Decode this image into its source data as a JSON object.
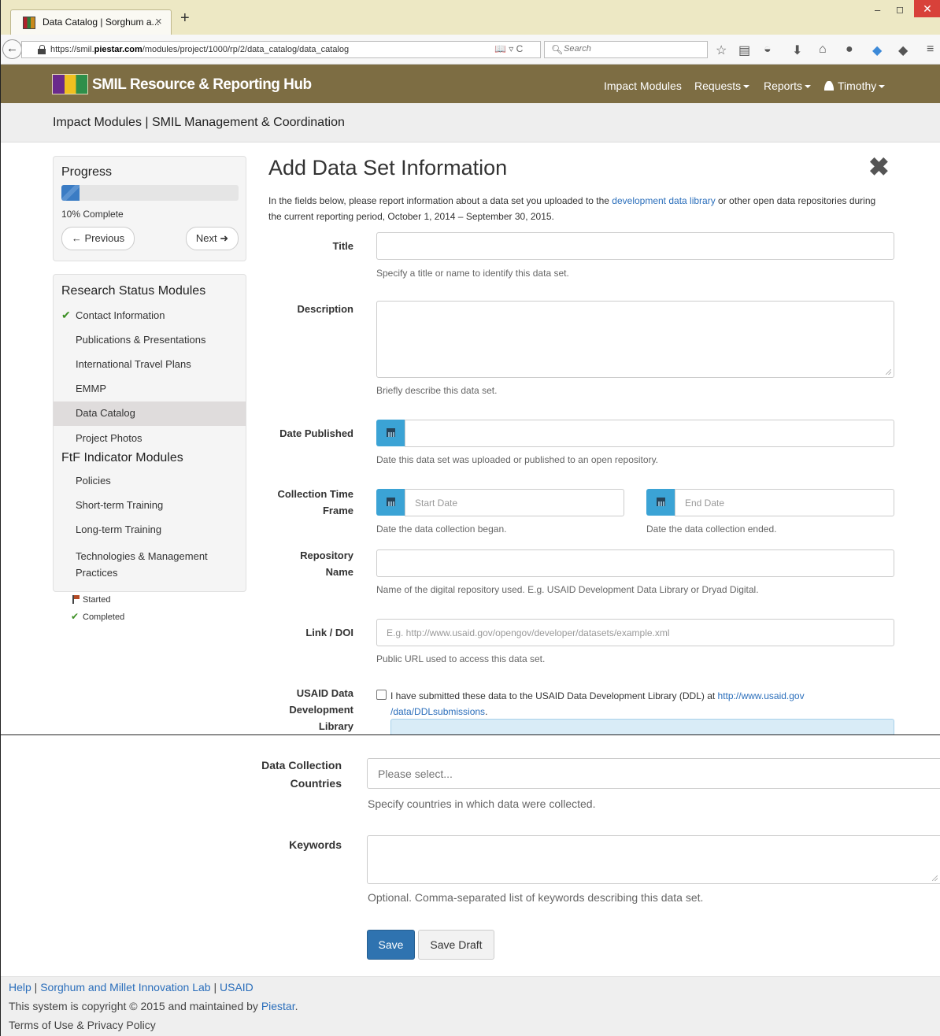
{
  "browser": {
    "tab_title": "Data Catalog | Sorghum a...",
    "tab_close": "×",
    "new_tab": "+",
    "url_prefix": "https://smil.",
    "url_domain": "piestar.com",
    "url_path": "/modules/project/1000/rp/2/data_catalog/data_catalog",
    "reader_icons": "📖 ▿ C",
    "search_placeholder": "Search",
    "window_min": "–",
    "window_max": "◻",
    "window_close": "✕"
  },
  "site": {
    "title": "SMIL Resource & Reporting Hub",
    "nav": {
      "impact_modules": "Impact Modules",
      "requests": "Requests",
      "reports": "Reports",
      "user": "Timothy"
    }
  },
  "subheader": {
    "title": "Impact Modules | SMIL Management & Coordination"
  },
  "progress": {
    "heading": "Progress",
    "value": 10,
    "label": "10% Complete",
    "previous": "← Previous",
    "next": "Next ➜"
  },
  "sidebar": {
    "research_heading": "Research Status Modules",
    "research_items": [
      {
        "label": "Contact Information",
        "completed": true
      },
      {
        "label": "Publications & Presentations"
      },
      {
        "label": "International Travel Plans"
      },
      {
        "label": "EMMP"
      },
      {
        "label": "Data Catalog",
        "active": true
      },
      {
        "label": "Project Photos"
      }
    ],
    "ftf_heading": "FtF Indicator Modules",
    "ftf_items": [
      {
        "label": "Policies"
      },
      {
        "label": "Short-term Training"
      },
      {
        "label": "Long-term Training"
      },
      {
        "label": "Technologies & Management Practices"
      }
    ],
    "legend": {
      "started": "Started",
      "completed": "Completed"
    }
  },
  "form": {
    "heading": "Add Data Set Information",
    "close_symbol": "✖",
    "intro_before": "In the fields below, please report information about a data set you uploaded to the ",
    "intro_link": "development data library",
    "intro_after": " or other open data repositories during the current reporting period, October 1, 2014 – September 30, 2015.",
    "title": {
      "label": "Title",
      "value": "",
      "help": "Specify a title or name to identify this data set."
    },
    "description": {
      "label": "Description",
      "value": "",
      "help": "Briefly describe this data set."
    },
    "date_published": {
      "label": "Date Published",
      "value": "",
      "help": "Date this data set was uploaded or published to an open repository."
    },
    "collection_time_frame": {
      "label_line1": "Collection Time",
      "label_line2": "Frame",
      "start_placeholder": "Start Date",
      "end_placeholder": "End Date",
      "start_help": "Date the data collection began.",
      "end_help": "Date the data collection ended."
    },
    "repository_name": {
      "label_line1": "Repository",
      "label_line2": "Name",
      "value": "",
      "help": "Name of the digital repository used. E.g. USAID Development Data Library or Dryad Digital."
    },
    "link_doi": {
      "label": "Link / DOI",
      "placeholder": "E.g. http://www.usaid.gov/opengov/developer/datasets/example.xml",
      "help": "Public URL used to access this data set."
    },
    "usaid_ddl": {
      "label_line1": "USAID Data",
      "label_line2": "Development",
      "label_line3": "Library",
      "checkbox_text": "I have submitted these data to the USAID Data Development Library (DDL) at ",
      "link_line1": "http://www.usaid.gov",
      "link_line2": "/data/DDLsubmissions",
      "link_period": ".",
      "checked": false
    },
    "countries": {
      "label_line1": "Data Collection",
      "label_line2": "Countries",
      "placeholder": "Please select...",
      "help": "Specify countries in which data were collected."
    },
    "keywords": {
      "label": "Keywords",
      "value": "",
      "help": "Optional. Comma-separated list of keywords describing this data set."
    },
    "save": "Save",
    "save_draft": "Save Draft"
  },
  "footer": {
    "help": "Help",
    "sep1": " | ",
    "lab": "Sorghum and Millet Innovation Lab",
    "sep2": " | ",
    "usaid": "USAID",
    "copyright_before": "This system is copyright © 2015 and maintained by ",
    "copyright_link": "Piestar",
    "copyright_after": ".",
    "terms": "Terms of Use & Privacy Policy"
  }
}
